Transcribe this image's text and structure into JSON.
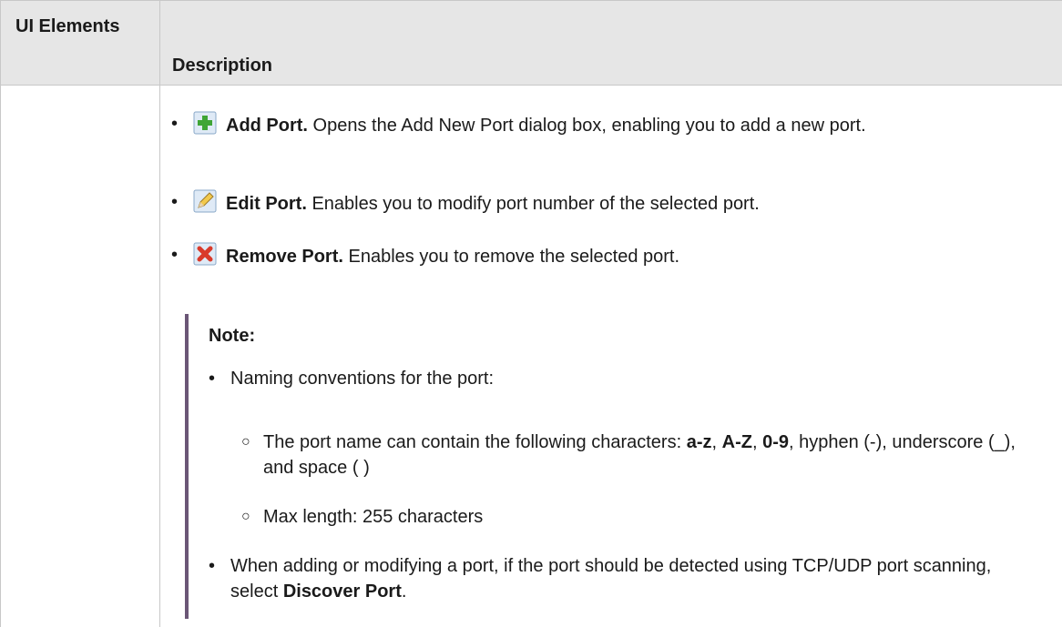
{
  "table": {
    "header": {
      "col1": "UI Elements",
      "col2": "Description"
    },
    "tools": [
      {
        "icon": "add-icon",
        "label": "Add Port.",
        "text": " Opens the Add New Port dialog box, enabling you to add a new port."
      },
      {
        "icon": "pencil-icon",
        "label": "Edit Port.",
        "text": " Enables you to modify port number of the selected port."
      },
      {
        "icon": "remove-icon",
        "label": "Remove Port.",
        "text": " Enables you to remove the selected port."
      }
    ],
    "note": {
      "title": "Note:",
      "item1": "Naming conventions for the port:",
      "sub1": {
        "prefix": "The port name can contain the following characters: ",
        "a_z": "a-z",
        "sep1": ", ",
        "A_Z": "A-Z",
        "sep2": ", ",
        "digits": "0-9",
        "suffix": ", hyphen (-), underscore (_), and space ( )"
      },
      "sub2": "Max length: 255 characters",
      "item2": {
        "prefix": "When adding or modifying a port, if the port should be detected using TCP/UDP port scanning, select ",
        "bold": "Discover Port",
        "suffix": "."
      }
    },
    "colors": {
      "header_bg": "#e6e6e6",
      "border": "#c8c8c8",
      "note_bar": "#6b5676",
      "add_green": "#3fa535",
      "remove_red": "#d93a2b"
    }
  }
}
